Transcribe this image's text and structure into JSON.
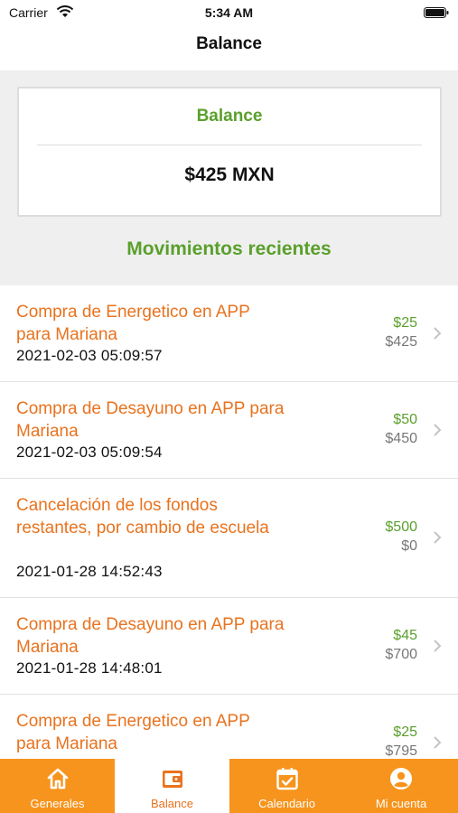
{
  "status_bar": {
    "carrier": "Carrier",
    "time": "5:34 AM"
  },
  "nav": {
    "title": "Balance"
  },
  "balance_card": {
    "label": "Balance",
    "amount": "$425 MXN"
  },
  "section": {
    "title": "Movimientos recientes"
  },
  "movements": [
    {
      "title": "Compra de Energetico en APP para Mariana",
      "date": "2021-02-03 05:09:57",
      "amount": "$25",
      "remaining": "$425"
    },
    {
      "title": "Compra de Desayuno en APP para Mariana",
      "date": "2021-02-03 05:09:54",
      "amount": "$50",
      "remaining": "$450"
    },
    {
      "title": "Cancelación de los fondos restantes, por cambio de escuela",
      "date": "2021-01-28 14:52:43",
      "amount": "$500",
      "remaining": "$0"
    },
    {
      "title": "Compra de Desayuno en APP para Mariana",
      "date": "2021-01-28 14:48:01",
      "amount": "$45",
      "remaining": "$700"
    },
    {
      "title": "Compra de Energetico en APP para Mariana",
      "date": "",
      "amount": "$25",
      "remaining": "$795"
    }
  ],
  "tabs": [
    {
      "label": "Generales",
      "icon": "home-icon"
    },
    {
      "label": "Balance",
      "icon": "wallet-icon",
      "active": true
    },
    {
      "label": "Calendario",
      "icon": "calendar-icon"
    },
    {
      "label": "Mi cuenta",
      "icon": "account-icon"
    }
  ],
  "colors": {
    "accent_orange": "#f7941d",
    "title_orange": "#e8731f",
    "green": "#5aa02c"
  }
}
